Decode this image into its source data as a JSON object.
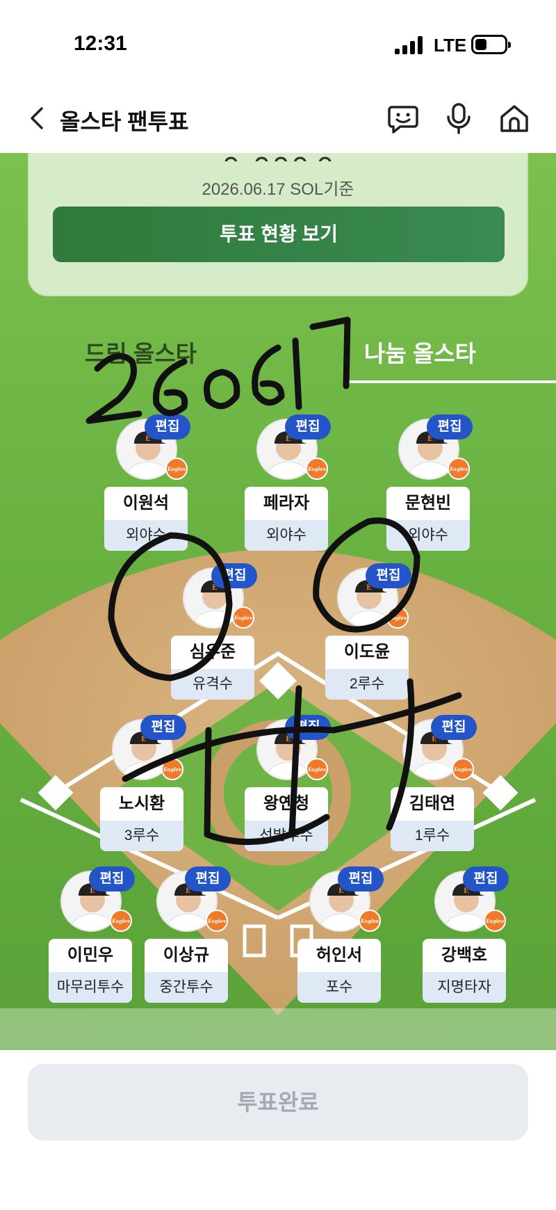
{
  "status_bar": {
    "time": "12:31",
    "network": "LTE"
  },
  "header": {
    "title": "올스타 팬투표"
  },
  "icons": {
    "back": "chevron-left-icon",
    "chat": "chat-face-icon",
    "mic": "microphone-icon",
    "home": "home-icon"
  },
  "vote_card": {
    "date_label": "2026.06.17 SOL기준",
    "button_label": "투표 현황 보기"
  },
  "tabs": [
    {
      "label": "드림 올스타",
      "active": false
    },
    {
      "label": "나눔 올스타",
      "active": true
    }
  ],
  "edit_label": "편집",
  "team_logo_text": "Eagles",
  "players": [
    {
      "name": "이원석",
      "position": "외야수"
    },
    {
      "name": "페라자",
      "position": "외야수"
    },
    {
      "name": "문현빈",
      "position": "외야수"
    },
    {
      "name": "심우준",
      "position": "유격수"
    },
    {
      "name": "이도윤",
      "position": "2루수"
    },
    {
      "name": "노시환",
      "position": "3루수"
    },
    {
      "name": "왕옌청",
      "position": "선발투수"
    },
    {
      "name": "김태연",
      "position": "1루수"
    },
    {
      "name": "이민우",
      "position": "마무리투수"
    },
    {
      "name": "이상규",
      "position": "중간투수"
    },
    {
      "name": "허인서",
      "position": "포수"
    },
    {
      "name": "강백호",
      "position": "지명타자"
    }
  ],
  "bottom": {
    "complete_label": "투표완료"
  },
  "handwritten_annotation": "260617",
  "colors": {
    "field_green": "#6ab342",
    "edit_blue": "#2355c9",
    "button_green": "#2f7a3c",
    "eagles_orange": "#f07a2a"
  }
}
